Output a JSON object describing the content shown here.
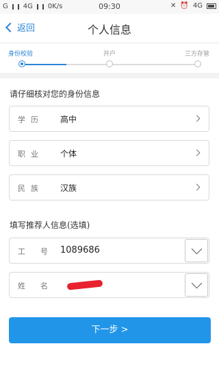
{
  "statusbar": {
    "carrier": "G",
    "network": "4G",
    "speed": "0K/s",
    "time": "09:30",
    "network_right": "4G"
  },
  "header": {
    "back_label": "返回",
    "title": "个人信息"
  },
  "stepper": {
    "steps": [
      {
        "label": "身份校验",
        "active": true
      },
      {
        "label": "开户",
        "active": false
      },
      {
        "label": "三方存管",
        "active": false
      }
    ]
  },
  "identity_section": {
    "title": "请仔细核对您的身份信息",
    "rows": [
      {
        "label": "学历",
        "value": "高中"
      },
      {
        "label": "职业",
        "value": "个体"
      },
      {
        "label": "民族",
        "value": "汉族"
      }
    ]
  },
  "referrer_section": {
    "title": "填写推荐人信息(选填)",
    "fields": [
      {
        "label": "工号",
        "value": "1089686"
      },
      {
        "label": "姓名",
        "value": ""
      }
    ]
  },
  "next_button": {
    "label": "下一步 >"
  },
  "colors": {
    "accent": "#2196e9",
    "link": "#2b84d6",
    "redaction": "#e8222e"
  }
}
